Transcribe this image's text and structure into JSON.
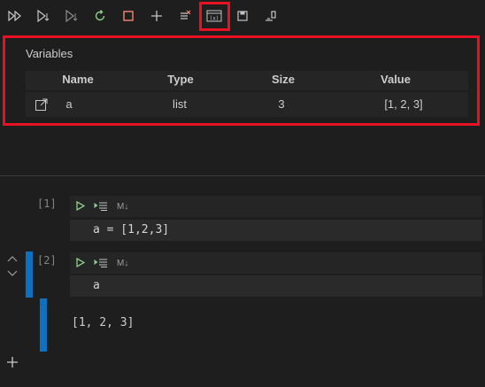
{
  "toolbar": {
    "buttons": [
      {
        "name": "run-all",
        "glyph": "▷▷"
      },
      {
        "name": "run-above",
        "glyph": "▷"
      },
      {
        "name": "run-below",
        "glyph": "▷"
      },
      {
        "name": "restart-kernel",
        "glyph": "↻"
      },
      {
        "name": "interrupt-kernel",
        "glyph": "□"
      },
      {
        "name": "add-cell",
        "glyph": "+"
      },
      {
        "name": "clear-outputs",
        "glyph": "≡"
      },
      {
        "name": "variables",
        "glyph": "(x)"
      },
      {
        "name": "save",
        "glyph": "▪"
      },
      {
        "name": "export",
        "glyph": "⇲"
      }
    ]
  },
  "variables_panel": {
    "title": "Variables",
    "columns": [
      "Name",
      "Type",
      "Size",
      "Value"
    ],
    "rows": [
      {
        "name": "a",
        "type": "list",
        "size": "3",
        "value": "[1, 2, 3]"
      }
    ]
  },
  "cells": [
    {
      "count": "[1]",
      "md_label": "M↓",
      "code": "a = [1,2,3]"
    },
    {
      "count": "[2]",
      "md_label": "M↓",
      "code": "a",
      "output": "[1, 2, 3]"
    }
  ],
  "colors": {
    "highlight": "#e81123",
    "run_green": "#89d185",
    "cell_bar": "#0e70c0"
  }
}
